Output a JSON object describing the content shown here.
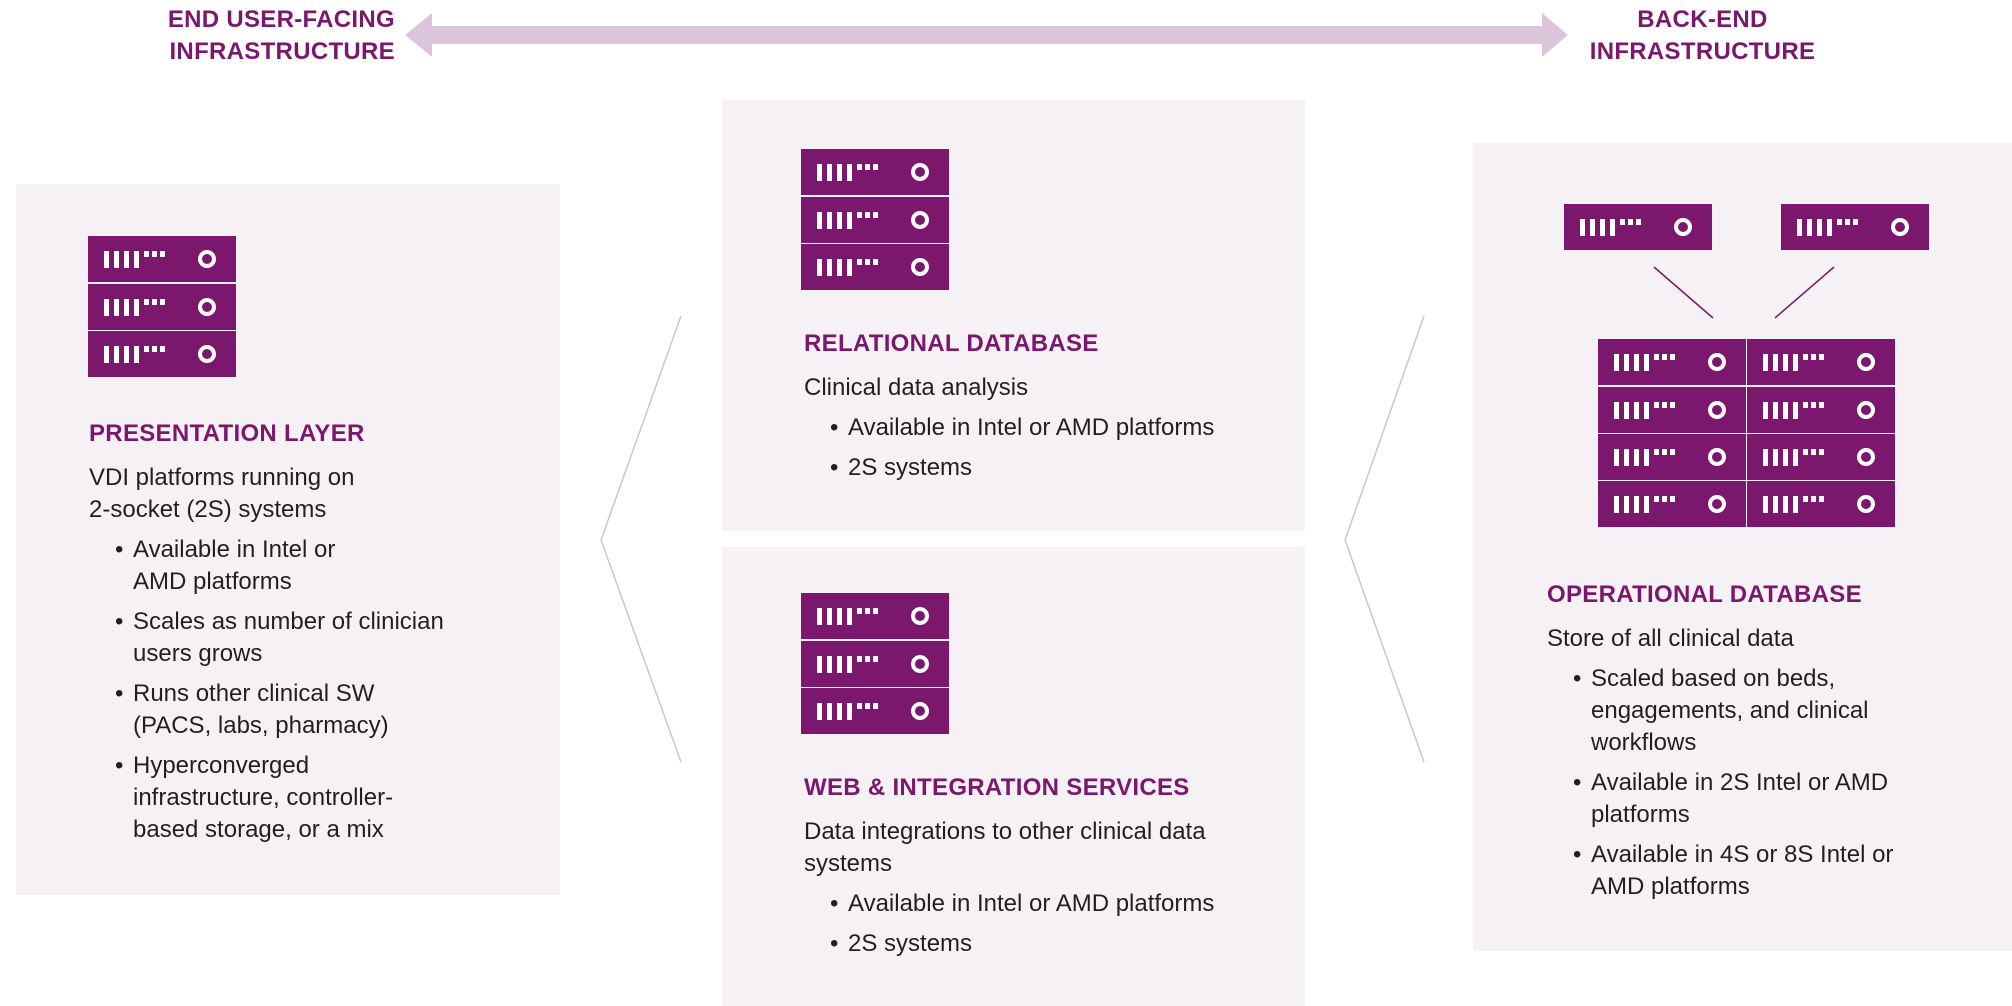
{
  "header": {
    "left_line1": "END USER-FACING",
    "left_line2": "INFRASTRUCTURE",
    "right_line1": "BACK-END",
    "right_line2": "INFRASTRUCTURE"
  },
  "colors": {
    "accent": "#7b176c",
    "arrow": "#dcc4db",
    "panel_bg": "#f6f1f5",
    "chevron": "#c8c8c8",
    "text": "#231f20"
  },
  "icons": {
    "server": "server-rack-icon",
    "arrow": "double-arrow-icon"
  },
  "panels": {
    "presentation": {
      "title": "PRESENTATION LAYER",
      "desc_line1": "VDI platforms running on",
      "desc_line2": "2-socket (2S) systems",
      "bullets": [
        [
          "Available in Intel or",
          "AMD platforms"
        ],
        [
          "Scales as number of clinician",
          "users grows"
        ],
        [
          "Runs other clinical SW",
          "(PACS, labs, pharmacy)"
        ],
        [
          "Hyperconverged",
          "infrastructure, controller-",
          "based storage, or a mix"
        ]
      ]
    },
    "relational": {
      "title": "RELATIONAL DATABASE",
      "desc": "Clinical data analysis",
      "bullets": [
        "Available in Intel or AMD platforms",
        "2S systems"
      ]
    },
    "web": {
      "title": "WEB & INTEGRATION SERVICES",
      "desc_line1": "Data integrations to other clinical data",
      "desc_line2": "systems",
      "bullets": [
        "Available in Intel or AMD platforms",
        "2S systems"
      ]
    },
    "operational": {
      "title": "OPERATIONAL DATABASE",
      "desc": "Store of all clinical data",
      "bullets": [
        [
          "Scaled based on beds,",
          "engagements, and clinical",
          "workflows"
        ],
        [
          "Available in 2S Intel or AMD",
          "platforms"
        ],
        [
          "Available in 4S or 8S Intel or",
          "AMD platforms"
        ]
      ]
    }
  }
}
